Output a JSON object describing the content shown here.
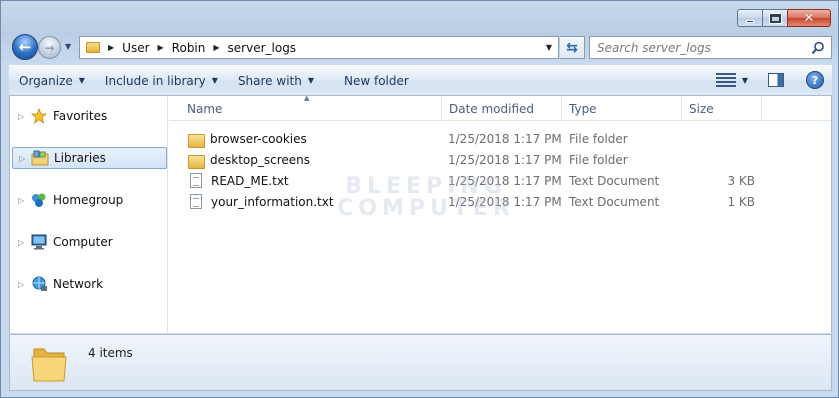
{
  "window": {
    "caption_buttons": {
      "minimize": "minimize",
      "maximize": "maximize",
      "close": "close"
    }
  },
  "address_bar": {
    "breadcrumbs": [
      "User",
      "Robin",
      "server_logs"
    ]
  },
  "search": {
    "placeholder": "Search server_logs"
  },
  "toolbar": {
    "organize_label": "Organize",
    "include_in_library_label": "Include in library",
    "share_with_label": "Share with",
    "new_folder_label": "New folder"
  },
  "nav_pane": {
    "items": [
      {
        "label": "Favorites",
        "icon": "star-icon",
        "selected": false
      },
      {
        "label": "Libraries",
        "icon": "libraries-icon",
        "selected": true
      },
      {
        "label": "Homegroup",
        "icon": "homegroup-icon",
        "selected": false
      },
      {
        "label": "Computer",
        "icon": "computer-icon",
        "selected": false
      },
      {
        "label": "Network",
        "icon": "network-icon",
        "selected": false
      }
    ]
  },
  "file_list": {
    "columns": [
      "Name",
      "Date modified",
      "Type",
      "Size"
    ],
    "rows": [
      {
        "name": "browser-cookies",
        "date": "1/25/2018 1:17 PM",
        "type": "File folder",
        "size": "",
        "icon": "folder-icon"
      },
      {
        "name": "desktop_screens",
        "date": "1/25/2018 1:17 PM",
        "type": "File folder",
        "size": "",
        "icon": "folder-icon"
      },
      {
        "name": "READ_ME.txt",
        "date": "1/25/2018 1:17 PM",
        "type": "Text Document",
        "size": "3 KB",
        "icon": "text-document-icon"
      },
      {
        "name": "your_information.txt",
        "date": "1/25/2018 1:17 PM",
        "type": "Text Document",
        "size": "1 KB",
        "icon": "text-document-icon"
      }
    ]
  },
  "watermark": {
    "line1": "BLEEPING",
    "line2": "COMPUTER"
  },
  "details": {
    "item_count": "4 items"
  }
}
